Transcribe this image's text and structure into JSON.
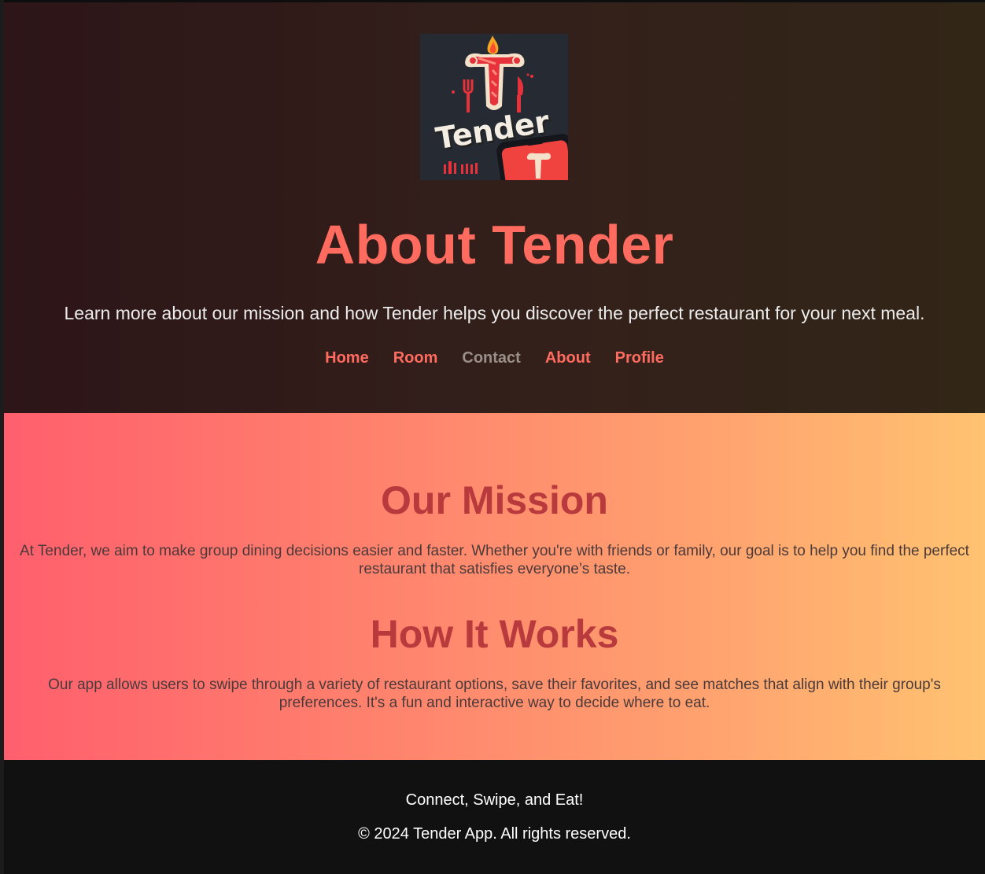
{
  "hero": {
    "logo_alt": "Tender",
    "logo_wordmark": "Tender",
    "title": "About Tender",
    "subtitle": "Learn more about our mission and how Tender helps you discover the perfect restaurant for your next meal."
  },
  "nav": {
    "items": [
      {
        "label": "Home"
      },
      {
        "label": "Room"
      },
      {
        "label": "Contact"
      },
      {
        "label": "About"
      },
      {
        "label": "Profile"
      }
    ]
  },
  "mission": {
    "heading": "Our Mission",
    "text": "At Tender, we aim to make group dining decisions easier and faster. Whether you're with friends or family, our goal is to help you find the perfect restaurant that satisfies everyone’s taste."
  },
  "how_it_works": {
    "heading": "How It Works",
    "text": "Our app allows users to swipe through a variety of restaurant options, save their favorites, and see matches that align with their group's preferences. It's a fun and interactive way to decide where to eat."
  },
  "footer": {
    "tagline": "Connect, Swipe, and Eat!",
    "copyright": "© 2024 Tender App. All rights reserved."
  },
  "colors": {
    "accent": "#ff6b5f",
    "heading_dark_red": "#b83a3d",
    "nav_muted": "#9a8f8a",
    "gradient_start": "#ff5f6d",
    "gradient_end": "#ffc371"
  }
}
